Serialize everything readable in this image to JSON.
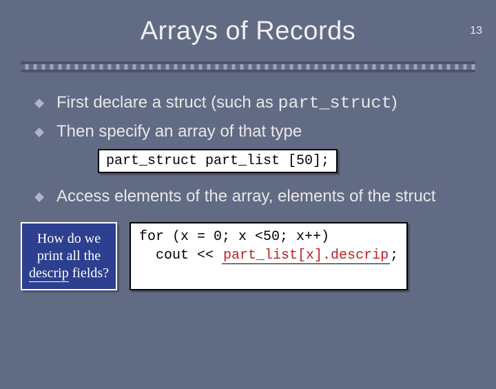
{
  "page_number": "13",
  "title": "Arrays of Records",
  "bullets": {
    "b1_prefix": "First declare a struct (such as ",
    "b1_code": "part_struct",
    "b1_suffix": ")",
    "b2": "Then specify an array of that type",
    "b3": "Access elements of the array, elements of the struct"
  },
  "code1": "part_struct part_list [50];",
  "code2_line1": "for (x = 0; x <50; x++)",
  "code2_line2_prefix": "  cout << ",
  "code2_fill": "part_list[x].descrip",
  "code2_line2_suffix": ";",
  "callout": {
    "line1": "How do we",
    "line2": "print all the",
    "underlined": "descrip",
    "line3_suffix": " fields?"
  }
}
